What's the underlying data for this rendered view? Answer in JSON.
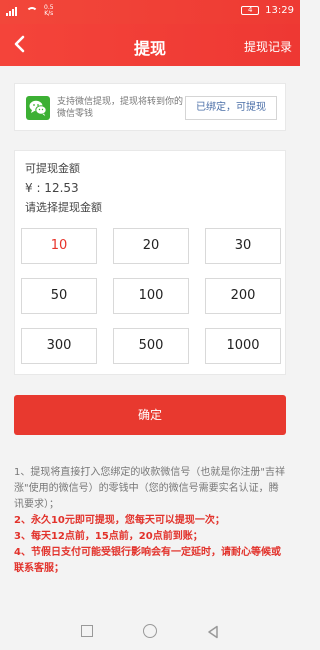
{
  "status": {
    "speed": "0.5\nK/s",
    "battery": "4",
    "time": "13:29"
  },
  "header": {
    "title": "提现",
    "record_label": "提现记录"
  },
  "wechat": {
    "description": "支持微信提现，提现将转到你的微信零钱",
    "bind_label": "已绑定，可提现"
  },
  "amount": {
    "available_label": "可提现金额",
    "balance": "¥ : 12.53",
    "choose_label": "请选择提现金额",
    "options": [
      "10",
      "20",
      "30",
      "50",
      "100",
      "200",
      "300",
      "500",
      "1000"
    ],
    "selected": "10"
  },
  "confirm_label": "确定",
  "notes": [
    "1、提现将直接打入您绑定的收款微信号（也就是你注册\"吉祥涨\"使用的微信号）的零钱中（您的微信号需要实名认证，腾讯要求）；",
    "2、永久10元即可提现，您每天可以提现一次；",
    "3、每天12点前，15点前，20点前到账；",
    "4、节假日支付可能受银行影响会有一定延时，请耐心等候或联系客服；"
  ],
  "colors": {
    "brand_red": "#ee3a33",
    "wechat_green": "#3cb034",
    "link_blue": "#4b6fa8"
  }
}
